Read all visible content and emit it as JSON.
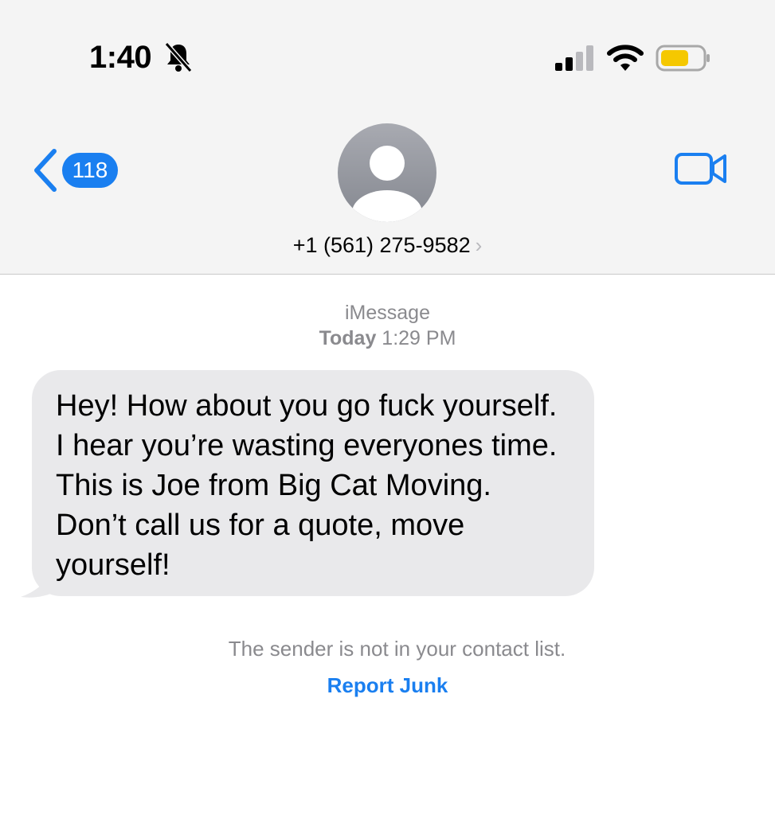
{
  "status_bar": {
    "time": "1:40",
    "icons": [
      "bell-slash-icon",
      "cellular-signal-icon",
      "wifi-icon",
      "battery-icon"
    ],
    "battery_color": "#f5c800"
  },
  "nav": {
    "back_icon": "chevron-left-icon",
    "unread_count": "118",
    "contact_name": "+1 (561) 275-9582",
    "contact_chevron": "›",
    "video_icon": "video-camera-icon",
    "accent_color": "#1a7ff0"
  },
  "conversation": {
    "service": "iMessage",
    "day": "Today",
    "time": "1:29 PM",
    "messages": [
      {
        "direction": "incoming",
        "text": "Hey! How about you go fuck yourself. I hear you’re wasting everyones time. This is Joe from Big Cat Moving. Don’t call us for a quote, move yourself!"
      }
    ]
  },
  "footer": {
    "notice": "The sender is not in your contact list.",
    "report_label": "Report Junk"
  }
}
